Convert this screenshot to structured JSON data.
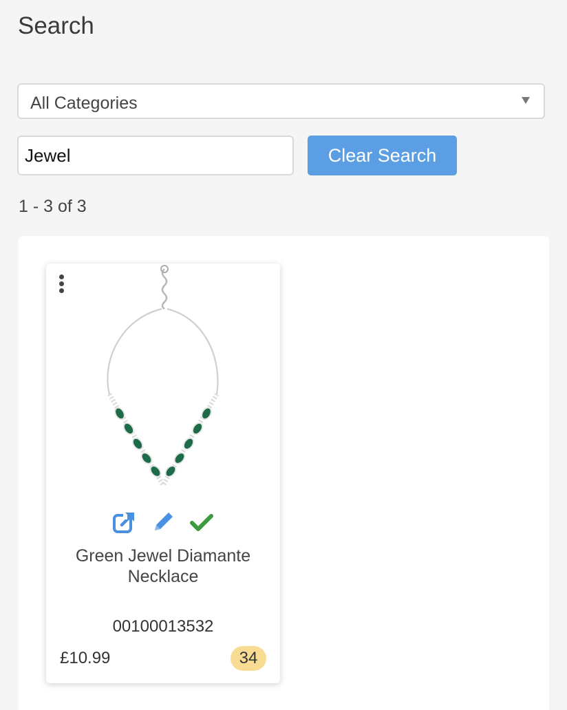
{
  "page": {
    "title": "Search"
  },
  "filters": {
    "category": {
      "selected": "All Categories"
    },
    "search": {
      "value": "Jewel"
    },
    "clear_label": "Clear Search"
  },
  "results": {
    "count_text": "1 - 3 of 3",
    "items": [
      {
        "name": "Green Jewel Diamante Necklace",
        "sku": "00100013532",
        "price": "£10.99",
        "stock": "34",
        "image": "necklace-image",
        "actions": [
          "external-link-icon",
          "pencil-icon",
          "check-icon"
        ]
      }
    ]
  },
  "colors": {
    "accent": "#5b9ee3",
    "edit_blue": "#4a90e2",
    "check_green": "#3e9a3e",
    "badge": "#f9dc94",
    "emerald": "#1e6b4a"
  }
}
